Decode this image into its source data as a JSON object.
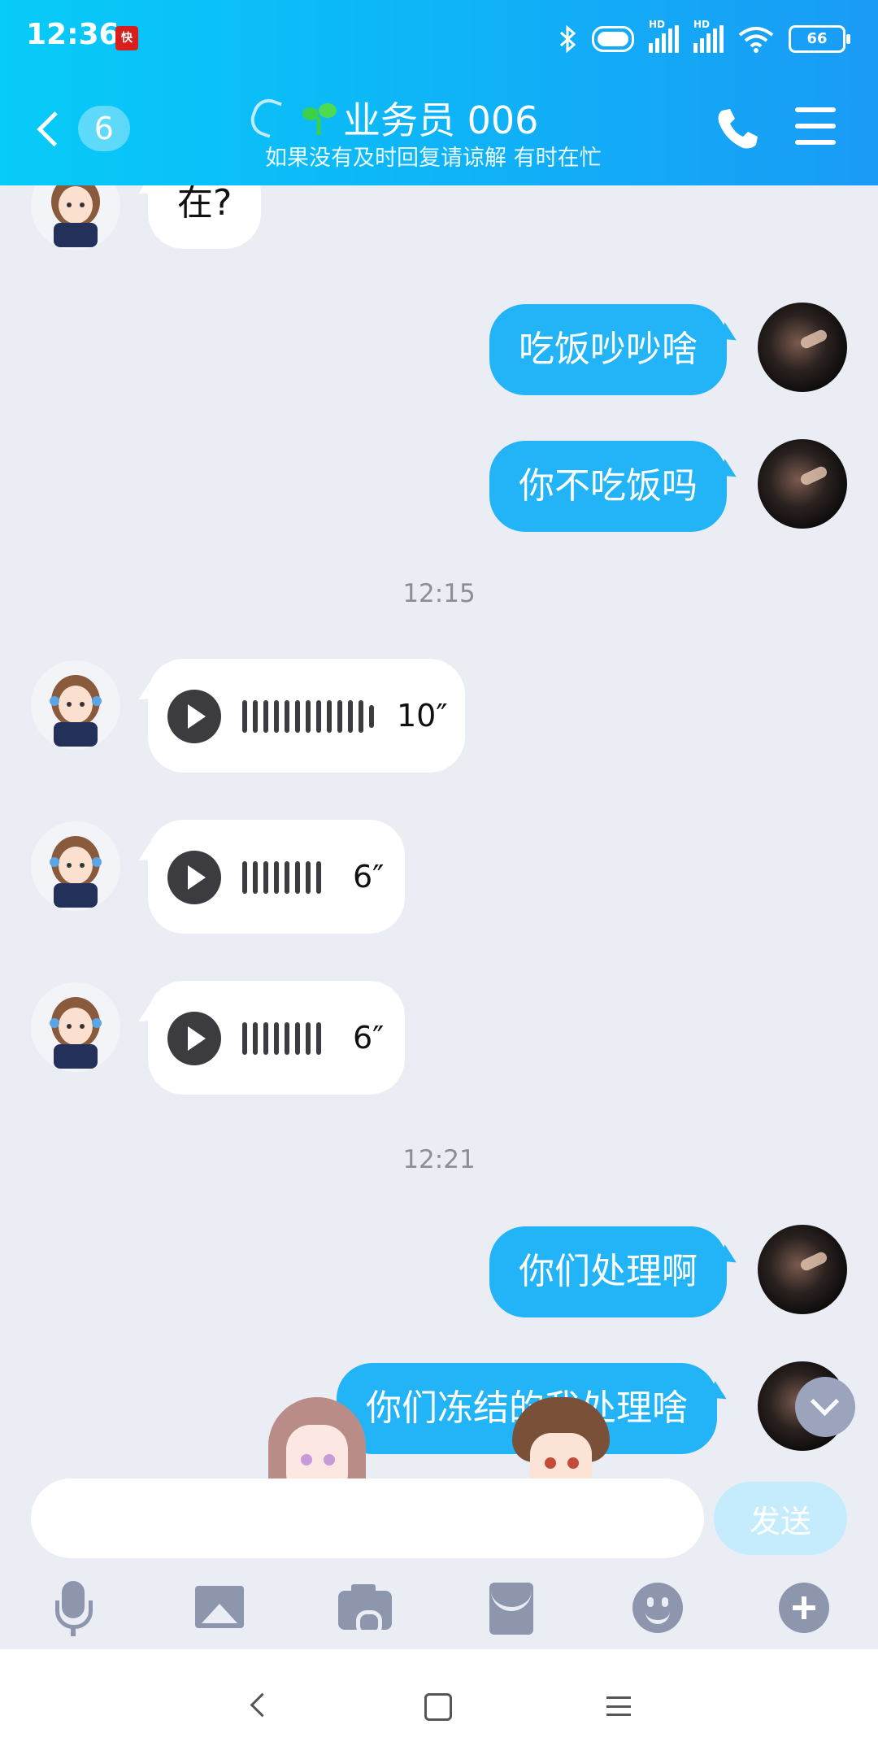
{
  "status_bar": {
    "time": "12:36",
    "badge": "快",
    "battery": "66",
    "hd_label": "HD"
  },
  "header": {
    "unread_count": "6",
    "title": "业务员 006",
    "subtitle": "如果没有及时回复请谅解 有时在忙"
  },
  "messages": [
    {
      "side": "left",
      "type": "text",
      "text": "在?"
    },
    {
      "side": "right",
      "type": "text",
      "text": "吃饭吵吵啥"
    },
    {
      "side": "right",
      "type": "text",
      "text": "你不吃饭吗"
    },
    {
      "type": "time",
      "text": "12:15"
    },
    {
      "side": "left",
      "type": "voice",
      "duration": "10″"
    },
    {
      "side": "left",
      "type": "voice",
      "duration": "6″"
    },
    {
      "side": "left",
      "type": "voice",
      "duration": "6″"
    },
    {
      "type": "time",
      "text": "12:21"
    },
    {
      "side": "right",
      "type": "text",
      "text": "你们处理啊"
    },
    {
      "side": "right",
      "type": "text",
      "text": "你们冻结的我处理啥"
    }
  ],
  "input": {
    "placeholder": "",
    "value": "",
    "send_label": "发送"
  },
  "toolbar": [
    "mic-icon",
    "image-icon",
    "camera-icon",
    "red-envelope-icon",
    "emoji-icon",
    "plus-icon"
  ],
  "colors": {
    "header_start": "#07cbf8",
    "header_end": "#1a9bf6",
    "outgoing_bubble": "#23b4f7",
    "background": "#ebedf5"
  }
}
